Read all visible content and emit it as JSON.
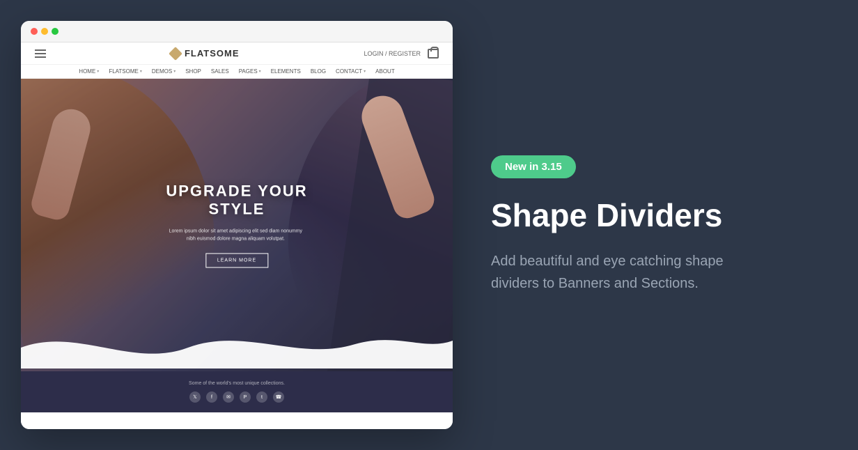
{
  "left": {
    "navbar": {
      "logo_text": "FLATSOME",
      "login_text": "LOGIN / REGISTER",
      "nav_links": [
        "HOME",
        "FLATSOME",
        "DEMOS",
        "SHOP",
        "SALES",
        "PAGES",
        "ELEMENTS",
        "BLOG",
        "CONTACT",
        "ABOUT"
      ]
    },
    "hero": {
      "title_line1": "UPGRADE YOUR",
      "title_line2": "STYLE",
      "subtitle": "Lorem ipsum dolor sit amet adipiscing elit sed diam nonummy nibh euismod dolore magna aliquam volutpat.",
      "cta_label": "LEARN MORE"
    },
    "footer": {
      "tagline": "Some of the world's most unique collections."
    }
  },
  "right": {
    "badge": "New  in 3.15",
    "title": "Shape Dividers",
    "description": "Add beautiful and eye catching shape dividers to Banners and Sections.",
    "colors": {
      "background": "#2d3748",
      "badge_bg": "#4ecb8b",
      "title_color": "#ffffff",
      "description_color": "#9aa5b4"
    }
  }
}
